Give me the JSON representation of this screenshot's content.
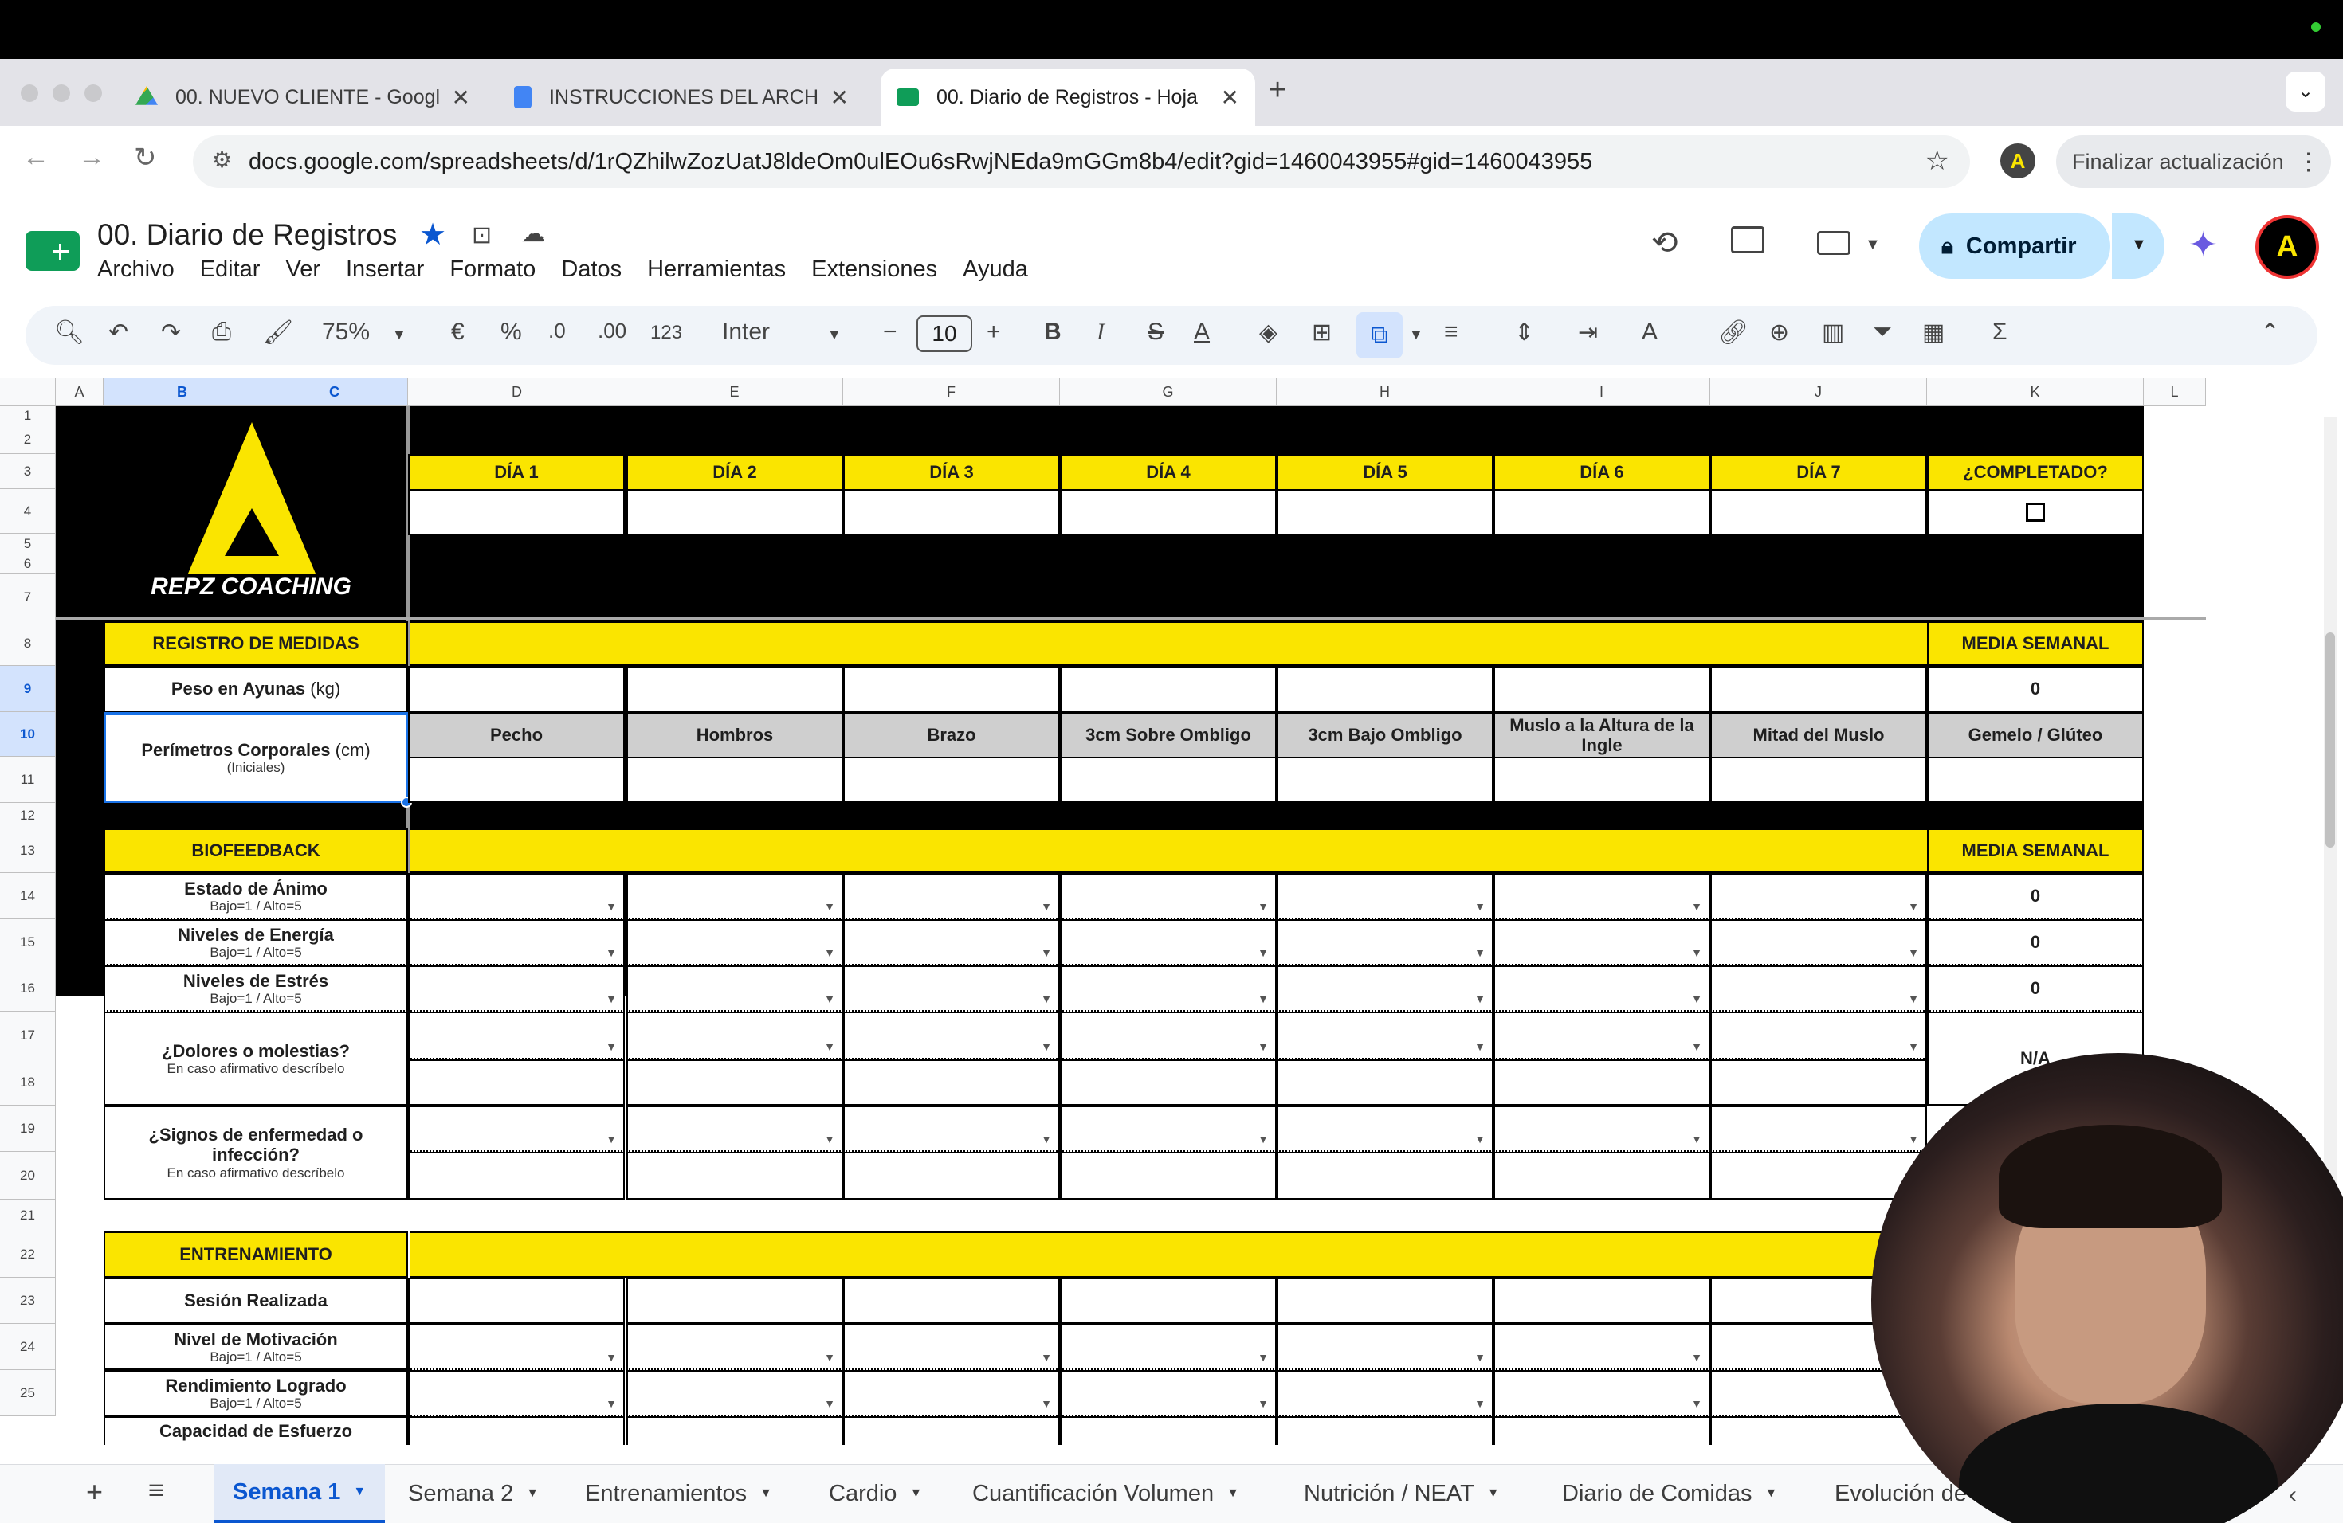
{
  "browser": {
    "tabs": [
      {
        "title": "00. NUEVO CLIENTE - Googl",
        "favicon": "drive-icon",
        "color": "#34a853"
      },
      {
        "title": "INSTRUCCIONES DEL ARCHI",
        "favicon": "docs-icon",
        "color": "#4285f4"
      },
      {
        "title": "00. Diario de Registros - Hoja",
        "favicon": "sheets-icon",
        "color": "#0f9d58"
      }
    ],
    "url": "docs.google.com/spreadsheets/d/1rQZhilwZozUatJ8ldeOm0ulEOu6sRwjNEda9mGGm8b4/edit?gid=1460043955#gid=1460043955",
    "update_label": "Finalizar actualización"
  },
  "doc": {
    "title": "00. Diario de Registros",
    "menu": [
      "Archivo",
      "Editar",
      "Ver",
      "Insertar",
      "Formato",
      "Datos",
      "Herramientas",
      "Extensiones",
      "Ayuda"
    ],
    "share_label": "Compartir"
  },
  "toolbar": {
    "zoom": "75%",
    "currency": "€",
    "percent": "%",
    "dec_minus": ".0",
    "dec_plus": ".00",
    "number_format": "123",
    "font": "Inter",
    "font_size": "10"
  },
  "columns": [
    "A",
    "B",
    "C",
    "D",
    "E",
    "F",
    "G",
    "H",
    "I",
    "J",
    "K",
    "L"
  ],
  "rows": [
    "1",
    "2",
    "3",
    "4",
    "5",
    "6",
    "7",
    "8",
    "9",
    "10",
    "11",
    "12",
    "13",
    "14",
    "15",
    "16",
    "17",
    "18",
    "19",
    "20",
    "21",
    "22",
    "23",
    "24",
    "25"
  ],
  "sheet": {
    "logo_text": "REPZ COACHING",
    "days": [
      "DÍA 1",
      "DÍA 2",
      "DÍA 3",
      "DÍA 4",
      "DÍA 5",
      "DÍA 6",
      "DÍA 7"
    ],
    "completed_label": "¿COMPLETADO?",
    "medidas_header": "REGISTRO DE MEDIDAS",
    "media_semanal": "MEDIA SEMANAL",
    "peso_label": "Peso en Ayunas",
    "peso_unit": "(kg)",
    "peso_media": "0",
    "perimetros_label": "Perímetros Corporales",
    "perimetros_unit": "(cm)",
    "perimetros_sub": "(Iniciales)",
    "perimetros_cols": [
      "Pecho",
      "Hombros",
      "Brazo",
      "3cm Sobre Ombligo",
      "3cm Bajo Ombligo",
      "Muslo a la Altura de la Ingle",
      "Mitad del Muslo",
      "Gemelo / Glúteo"
    ],
    "biofeedback_header": "BIOFEEDBACK",
    "bio_rows": [
      {
        "label": "Estado de Ánimo",
        "sub": "Bajo=1 / Alto=5",
        "media": "0"
      },
      {
        "label": "Niveles de Energía",
        "sub": "Bajo=1 / Alto=5",
        "media": "0"
      },
      {
        "label": "Niveles de Estrés",
        "sub": "Bajo=1 / Alto=5",
        "media": "0"
      }
    ],
    "dolores_label": "¿Dolores o molestias?",
    "dolores_sub": "En caso afirmativo descríbelo",
    "dolores_media": "N/A",
    "signos_label": "¿Signos de enfermedad o infección?",
    "signos_sub": "En caso afirmativo descríbelo",
    "entrenamiento_header": "ENTRENAMIENTO",
    "sesion_label": "Sesión Realizada",
    "motivacion_label": "Nivel de Motivación",
    "motivacion_sub": "Bajo=1 / Alto=5",
    "rendimiento_label": "Rendimiento Logrado",
    "rendimiento_sub": "Bajo=1 / Alto=5",
    "capacidad_label": "Capacidad de Esfuerzo"
  },
  "sheet_tabs": [
    "Semana 1",
    "Semana 2",
    "Entrenamientos",
    "Cardio",
    "Cuantificación Volumen",
    "Nutrición / NEAT",
    "Diario de Comidas",
    "Evolución de"
  ],
  "colors": {
    "yellow": "#fae500",
    "black": "#000000",
    "grey": "#cfcfcf",
    "accent": "#0b57d0"
  }
}
